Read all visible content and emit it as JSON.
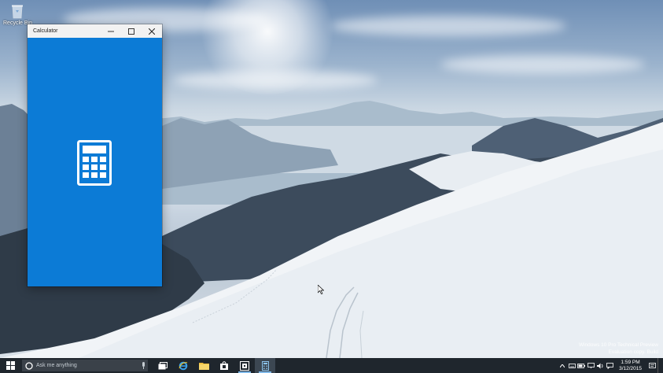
{
  "desktop": {
    "recycle_bin_label": "Recycle Bin",
    "watermark": {
      "line1": "Windows 10 Pro Technical Preview",
      "line2": "Evaluation copy. Build"
    }
  },
  "calculator_window": {
    "title": "Calculator",
    "accent_color": "#0c7bd6",
    "controls": [
      "minimize",
      "maximize",
      "close"
    ]
  },
  "taskbar": {
    "search_placeholder": "Ask me anything",
    "pinned_icons": [
      "task-view-icon",
      "internet-explorer-icon",
      "file-explorer-icon",
      "store-icon",
      "store-alt-icon",
      "calculator-icon"
    ],
    "clock": {
      "time": "1:59 PM",
      "date": "3/12/2015"
    }
  }
}
